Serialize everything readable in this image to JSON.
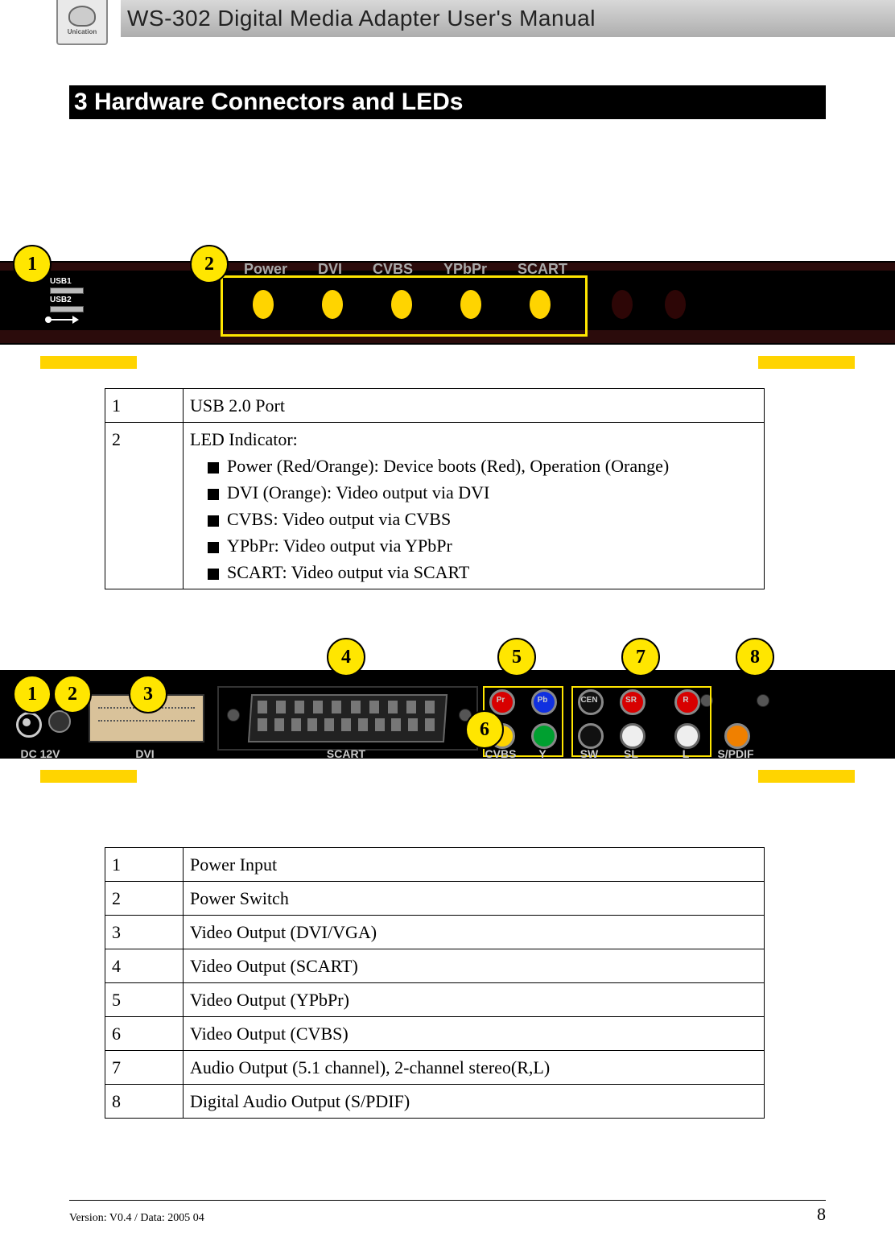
{
  "header": {
    "title": "WS-302 Digital Media Adapter User's Manual",
    "logo_text": "Unication"
  },
  "chapter": {
    "title": "3  Hardware Connectors and LEDs"
  },
  "front_panel": {
    "bubbles": {
      "b1": "1",
      "b2": "2"
    },
    "usb1": "USB1",
    "usb2": "USB2",
    "led_labels": [
      "Power",
      "DVI",
      "CVBS",
      "YPbPr",
      "SCART"
    ]
  },
  "front_table": {
    "rows": [
      {
        "num": "1",
        "text": "USB 2.0 Port"
      }
    ],
    "row2": {
      "num": "2",
      "intro": "LED Indicator:",
      "bullets": [
        "Power (Red/Orange): Device boots (Red), Operation (Orange)",
        "DVI (Orange): Video output via DVI",
        "CVBS: Video output via CVBS",
        "YPbPr: Video output via YPbPr",
        "SCART: Video output via SCART"
      ]
    }
  },
  "rear_panel": {
    "bubbles": {
      "b1": "1",
      "b2": "2",
      "b3": "3",
      "b4": "4",
      "b5": "5",
      "b6": "6",
      "b7": "7",
      "b8": "8"
    },
    "labels": {
      "dc": "DC 12V",
      "dvi": "DVI",
      "scart": "SCART",
      "cvbs": "CVBS",
      "y": "Y",
      "sw": "SW",
      "sl": "SL",
      "l": "L",
      "spdif": "S/PDIF",
      "pr": "Pr",
      "pb": "Pb",
      "cen": "CEN",
      "sr": "SR",
      "r": "R"
    }
  },
  "rear_table": {
    "rows": [
      {
        "num": "1",
        "text": "Power Input"
      },
      {
        "num": "2",
        "text": "Power Switch"
      },
      {
        "num": "3",
        "text": "Video Output (DVI/VGA)"
      },
      {
        "num": "4",
        "text": "Video Output (SCART)"
      },
      {
        "num": "5",
        "text": "Video Output (YPbPr)"
      },
      {
        "num": "6",
        "text": "Video Output (CVBS)"
      },
      {
        "num": "7",
        "text": "Audio Output (5.1 channel), 2-channel stereo(R,L)"
      },
      {
        "num": "8",
        "text": "Digital Audio Output (S/PDIF)"
      }
    ]
  },
  "footer": {
    "version": "Version: V0.4 / Data: 2005 04",
    "page": "8"
  }
}
